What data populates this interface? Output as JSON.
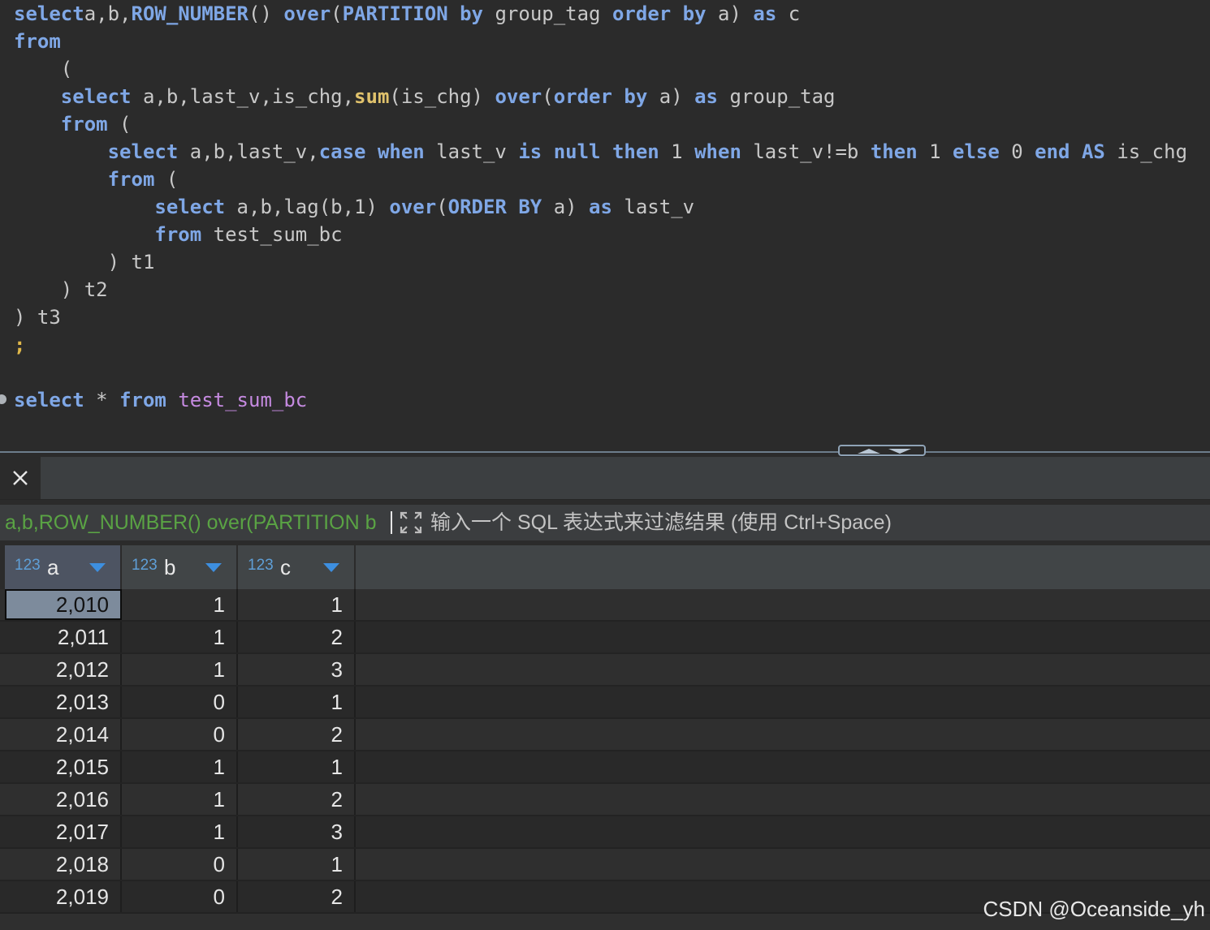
{
  "editor": {
    "lines": [
      [
        [
          "kw",
          "select"
        ],
        [
          "",
          "a,b,"
        ],
        [
          "kw",
          "ROW_NUMBER"
        ],
        [
          "",
          "() "
        ],
        [
          "kw",
          "over"
        ],
        [
          "",
          "("
        ],
        [
          "kw",
          "PARTITION"
        ],
        [
          "",
          " "
        ],
        [
          "kw",
          "by"
        ],
        [
          "",
          " group_tag "
        ],
        [
          "kw",
          "order"
        ],
        [
          "",
          " "
        ],
        [
          "kw",
          "by"
        ],
        [
          "",
          " a) "
        ],
        [
          "kw",
          "as"
        ],
        [
          "",
          " c"
        ]
      ],
      [
        [
          "kw",
          "from"
        ]
      ],
      [
        [
          "",
          "    ("
        ]
      ],
      [
        [
          "",
          "    "
        ],
        [
          "kw",
          "select"
        ],
        [
          "",
          " a,b,last_v,is_chg,"
        ],
        [
          "fn",
          "sum"
        ],
        [
          "",
          "(is_chg) "
        ],
        [
          "kw",
          "over"
        ],
        [
          "",
          "("
        ],
        [
          "kw",
          "order"
        ],
        [
          "",
          " "
        ],
        [
          "kw",
          "by"
        ],
        [
          "",
          " a) "
        ],
        [
          "kw",
          "as"
        ],
        [
          "",
          " group_tag"
        ]
      ],
      [
        [
          "",
          "    "
        ],
        [
          "kw",
          "from"
        ],
        [
          "",
          " ("
        ]
      ],
      [
        [
          "",
          "        "
        ],
        [
          "kw",
          "select"
        ],
        [
          "",
          " a,b,last_v,"
        ],
        [
          "kw",
          "case"
        ],
        [
          "",
          " "
        ],
        [
          "kw",
          "when"
        ],
        [
          "",
          " last_v "
        ],
        [
          "kw",
          "is"
        ],
        [
          "",
          " "
        ],
        [
          "kw",
          "null"
        ],
        [
          "",
          " "
        ],
        [
          "kw",
          "then"
        ],
        [
          "",
          " 1 "
        ],
        [
          "kw",
          "when"
        ],
        [
          "",
          " last_v!=b "
        ],
        [
          "kw",
          "then"
        ],
        [
          "",
          " 1 "
        ],
        [
          "kw",
          "else"
        ],
        [
          "",
          " 0 "
        ],
        [
          "kw",
          "end"
        ],
        [
          "",
          " "
        ],
        [
          "kw",
          "AS"
        ],
        [
          "",
          " is_chg"
        ]
      ],
      [
        [
          "",
          "        "
        ],
        [
          "kw",
          "from"
        ],
        [
          "",
          " ("
        ]
      ],
      [
        [
          "",
          "            "
        ],
        [
          "kw",
          "select"
        ],
        [
          "",
          " a,b,lag(b,1) "
        ],
        [
          "kw",
          "over"
        ],
        [
          "",
          "("
        ],
        [
          "kw",
          "ORDER"
        ],
        [
          "",
          " "
        ],
        [
          "kw",
          "BY"
        ],
        [
          "",
          " a) "
        ],
        [
          "kw",
          "as"
        ],
        [
          "",
          " last_v"
        ]
      ],
      [
        [
          "",
          "            "
        ],
        [
          "kw",
          "from"
        ],
        [
          "",
          " test_sum_bc"
        ]
      ],
      [
        [
          "",
          "        ) t1"
        ]
      ],
      [
        [
          "",
          "    ) t2"
        ]
      ],
      [
        [
          "",
          ") t3"
        ]
      ],
      [
        [
          "semi",
          ";"
        ]
      ],
      [
        [
          "",
          ""
        ]
      ],
      [
        [
          "kw",
          "select"
        ],
        [
          "",
          " * "
        ],
        [
          "kw",
          "from"
        ],
        [
          "",
          " "
        ],
        [
          "tbl",
          "test_sum_bc"
        ]
      ]
    ]
  },
  "results": {
    "close_icon": "close-icon",
    "filter": {
      "query_text": "a,b,ROW_NUMBER() over(PARTITION b",
      "placeholder": "输入一个 SQL 表达式来过滤结果 (使用 Ctrl+Space)"
    },
    "columns": [
      {
        "type": "123",
        "name": "a"
      },
      {
        "type": "123",
        "name": "b"
      },
      {
        "type": "123",
        "name": "c"
      }
    ],
    "rows": [
      [
        "2,010",
        "1",
        "1"
      ],
      [
        "2,011",
        "1",
        "2"
      ],
      [
        "2,012",
        "1",
        "3"
      ],
      [
        "2,013",
        "0",
        "1"
      ],
      [
        "2,014",
        "0",
        "2"
      ],
      [
        "2,015",
        "1",
        "1"
      ],
      [
        "2,016",
        "1",
        "2"
      ],
      [
        "2,017",
        "1",
        "3"
      ],
      [
        "2,018",
        "0",
        "1"
      ],
      [
        "2,019",
        "0",
        "2"
      ]
    ]
  },
  "watermark": "CSDN @Oceanside_yh"
}
